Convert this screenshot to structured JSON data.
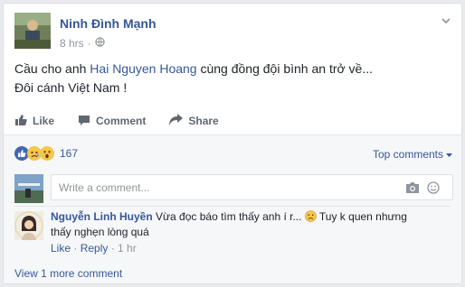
{
  "post": {
    "author": "Ninh Đình Mạnh",
    "time": "8 hrs",
    "privacy_icon": "globe-icon",
    "text_before": "Cầu cho anh ",
    "mention": "Hai Nguyen Hoang",
    "text_after": " cùng đồng đội bình an trở về...",
    "text_line2": "Đôi cánh Việt Nam !"
  },
  "actions": {
    "like": "Like",
    "comment": "Comment",
    "share": "Share"
  },
  "summary": {
    "reactions": [
      "like-reaction-icon",
      "sad-reaction-icon",
      "wow-reaction-icon"
    ],
    "count": "167",
    "top_comments": "Top comments"
  },
  "composer": {
    "placeholder": "Write a comment..."
  },
  "comment": {
    "author": "Nguyễn Linh Huyền",
    "text_before": " Vừa đọc báo tìm thấy anh í r... ",
    "text_after": " Tuy k quen nhưng thấy nghẹn lòng quá",
    "like": "Like",
    "dot1": " · ",
    "reply": "Reply",
    "dot2": " · ",
    "time": "1 hr"
  },
  "view_more": "View 1 more comment",
  "colors": {
    "link": "#365899",
    "muted": "#90949c",
    "background": "#e9ebee"
  }
}
